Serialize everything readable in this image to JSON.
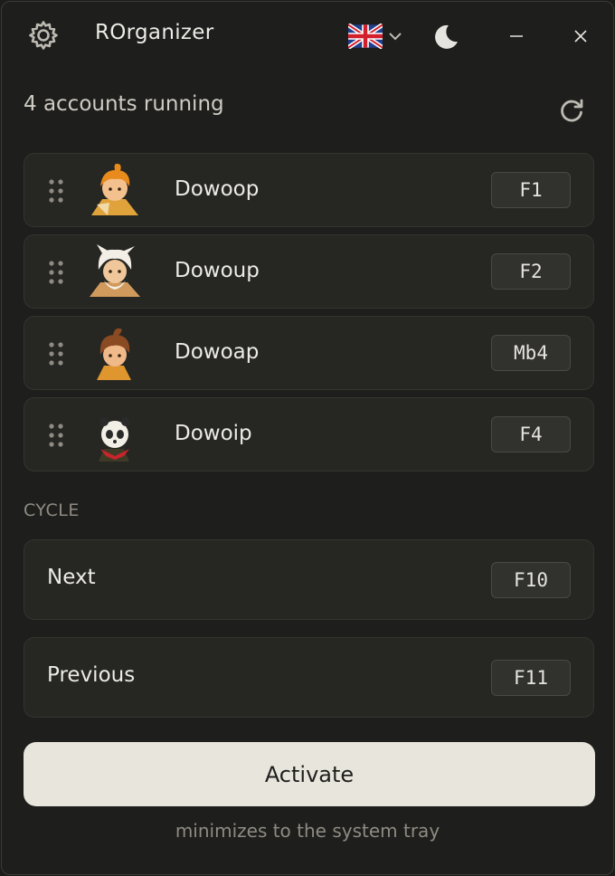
{
  "app": {
    "title": "ROrganizer",
    "language_flag": "uk-flag-icon",
    "icons": [
      "gear-icon",
      "chevron-down-icon",
      "moon-icon",
      "minimize-icon",
      "close-icon",
      "refresh-icon",
      "drag-handle-icon"
    ]
  },
  "status": {
    "text": "4 accounts running"
  },
  "accounts": [
    {
      "name": "Dowoop",
      "key": "F1",
      "avatar": "orange-haired-character-avatar"
    },
    {
      "name": "Dowoup",
      "key": "F2",
      "avatar": "white-haired-character-avatar"
    },
    {
      "name": "Dowoap",
      "key": "Mb4",
      "avatar": "brown-haired-character-avatar"
    },
    {
      "name": "Dowoip",
      "key": "F4",
      "avatar": "panda-character-avatar"
    }
  ],
  "cycle": {
    "label": "CYCLE",
    "next": {
      "label": "Next",
      "key": "F10"
    },
    "previous": {
      "label": "Previous",
      "key": "F11"
    }
  },
  "activate": {
    "label": "Activate",
    "note": "minimizes to the system tray"
  },
  "colors": {
    "background": "#1e1e1c",
    "row": "#262622",
    "button": "#e8e5dd",
    "text": "#ecebe6",
    "muted": "#8e8b83"
  }
}
